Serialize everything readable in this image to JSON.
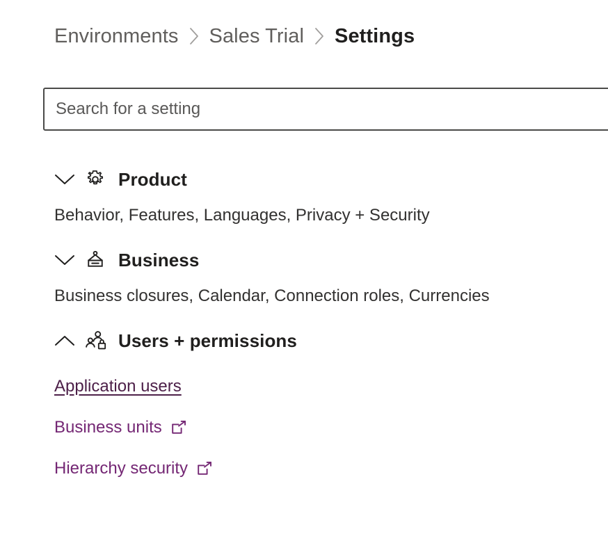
{
  "breadcrumb": {
    "items": [
      {
        "label": "Environments",
        "current": false
      },
      {
        "label": "Sales Trial",
        "current": false
      },
      {
        "label": "Settings",
        "current": true
      }
    ],
    "separator_icon": "chevron-right-icon"
  },
  "search": {
    "placeholder": "Search for a setting",
    "value": "",
    "icon": "search-icon"
  },
  "groups": [
    {
      "id": "product",
      "title": "Product",
      "icon": "gear-icon",
      "expanded": false,
      "toggle_icon": "chevron-down-icon",
      "description": "Behavior, Features, Languages, Privacy + Security"
    },
    {
      "id": "business",
      "title": "Business",
      "icon": "hanging-sign-icon",
      "expanded": false,
      "toggle_icon": "chevron-down-icon",
      "description": "Business closures, Calendar, Connection roles, Currencies"
    },
    {
      "id": "users-permissions",
      "title": "Users + permissions",
      "icon": "users-lock-icon",
      "expanded": true,
      "toggle_icon": "chevron-up-icon",
      "links": [
        {
          "label": "Application users",
          "external": false,
          "active": true
        },
        {
          "label": "Business units",
          "external": true,
          "active": false,
          "external_icon": "open-in-new-window-icon"
        },
        {
          "label": "Hierarchy security",
          "external": true,
          "active": false,
          "external_icon": "open-in-new-window-icon"
        }
      ]
    }
  ],
  "colors": {
    "link_purple": "#742774",
    "link_active": "#4d2049",
    "text_primary": "#201f1e",
    "text_secondary": "#605e5c",
    "border": "#4a4a48"
  }
}
